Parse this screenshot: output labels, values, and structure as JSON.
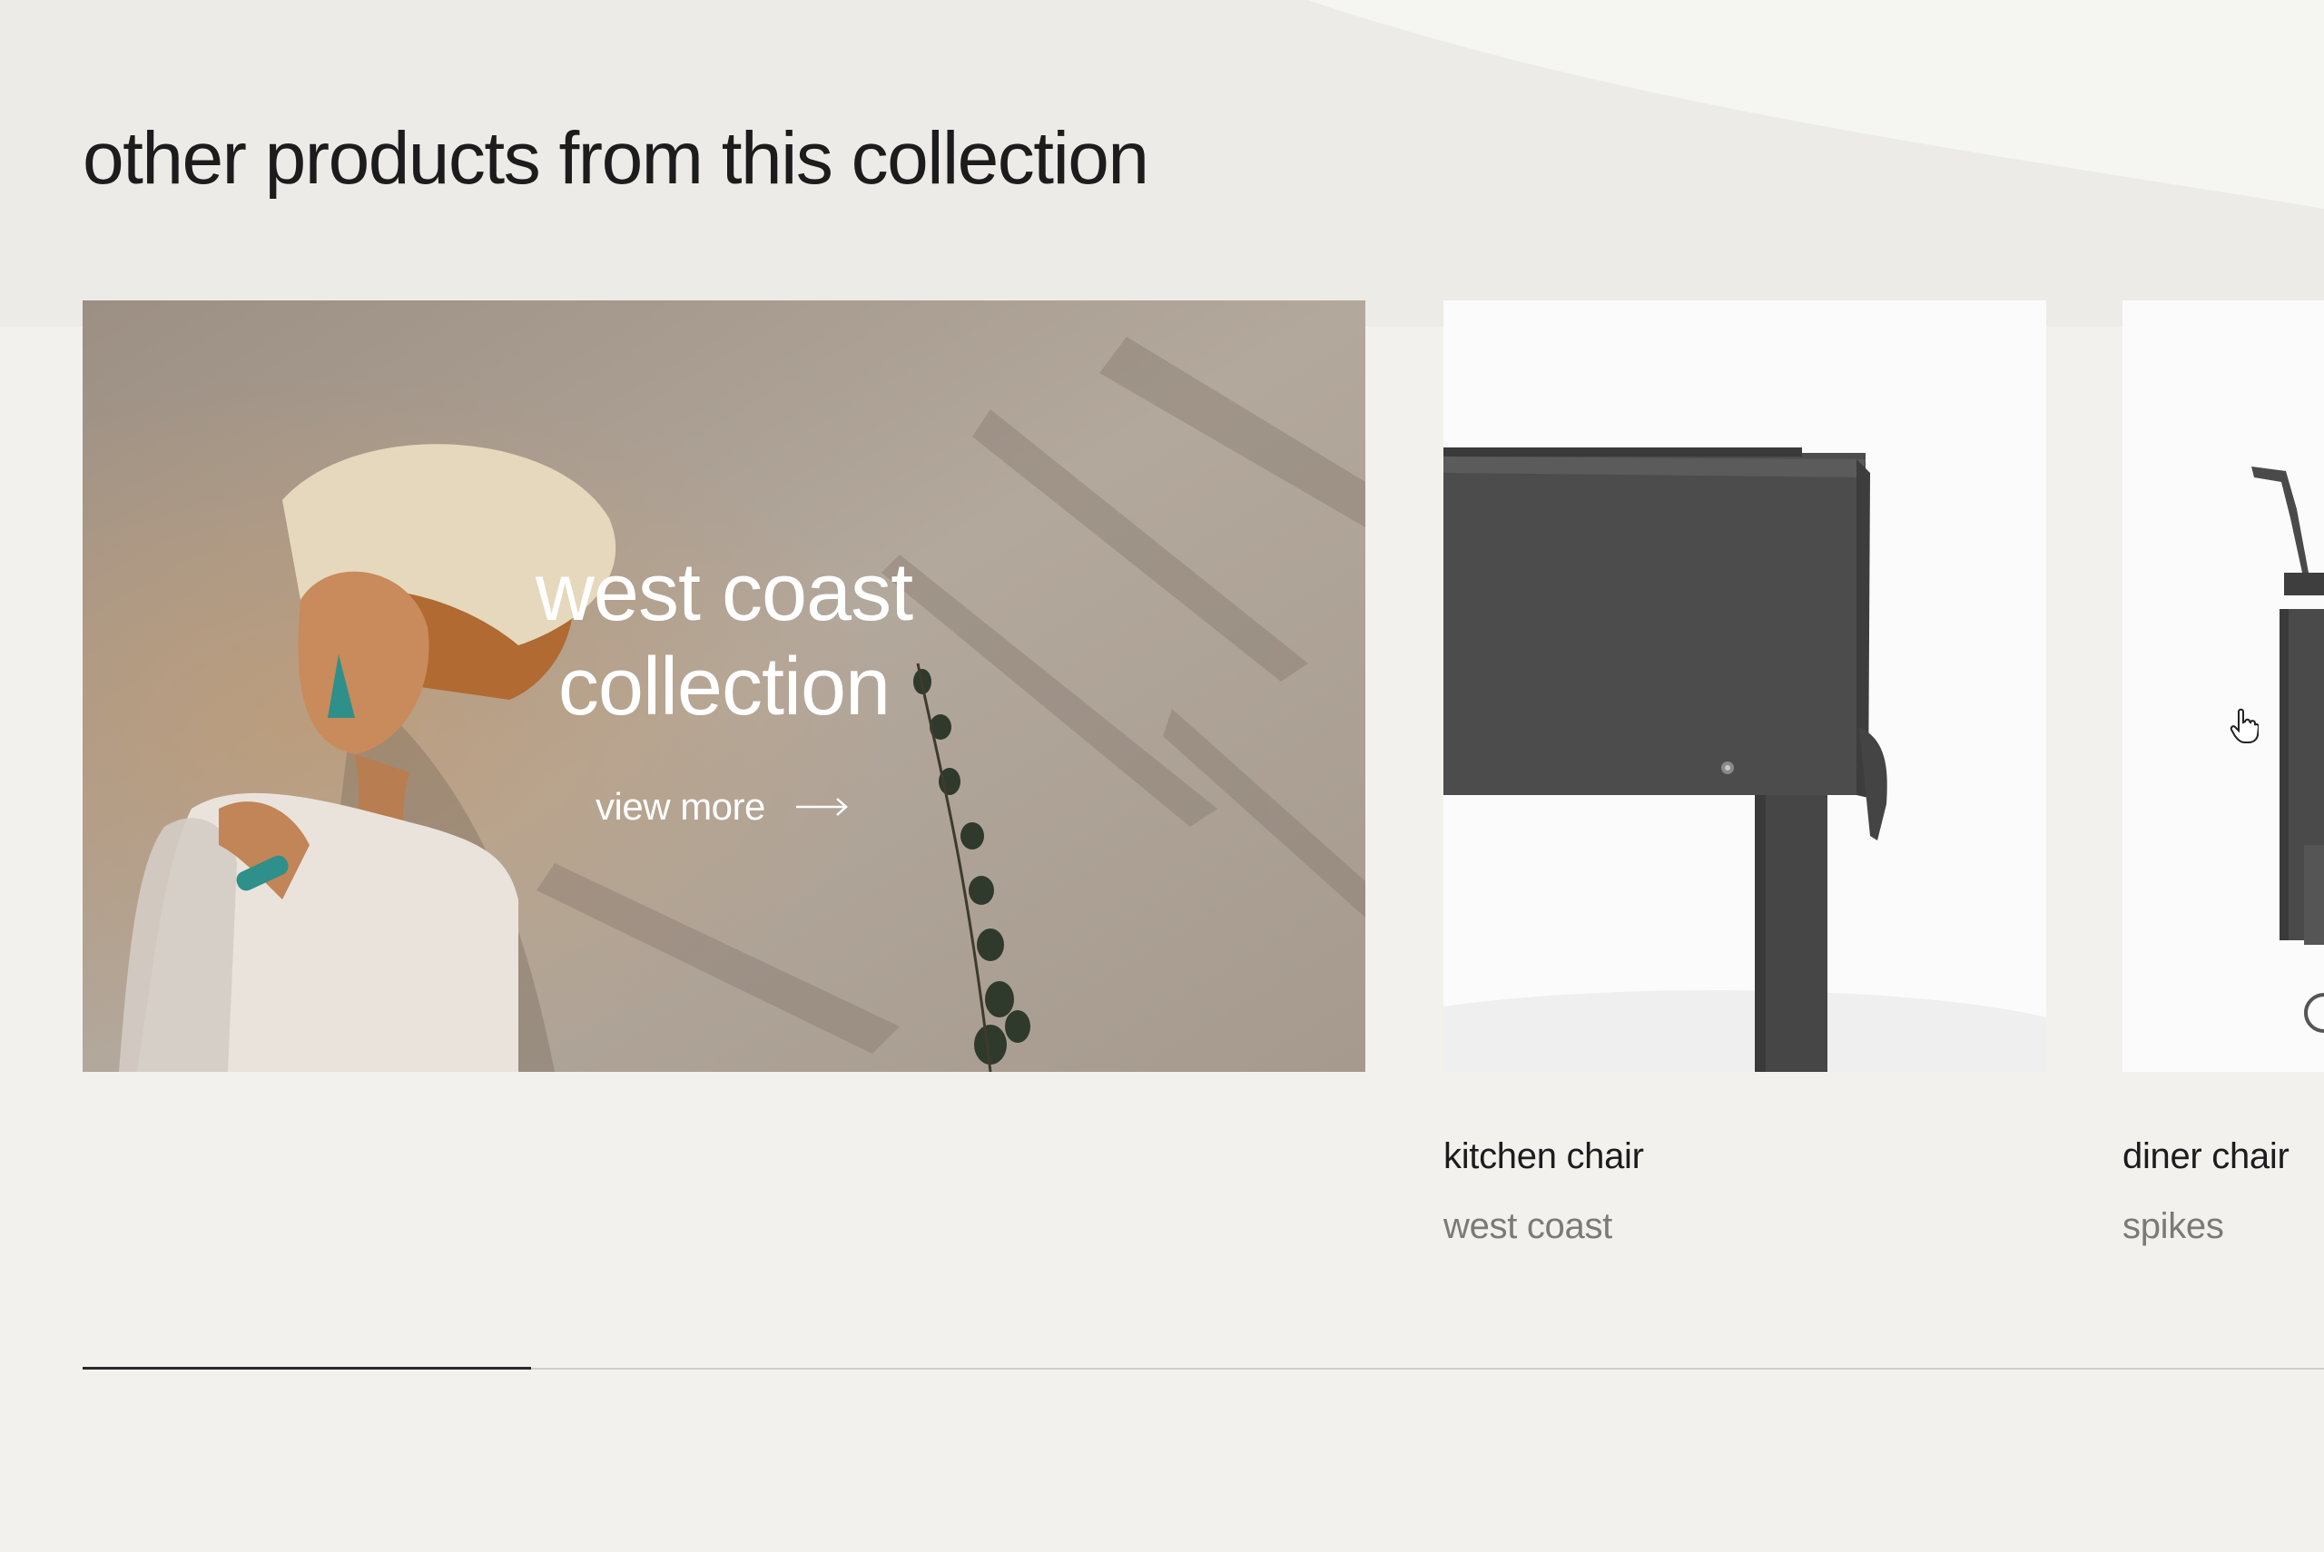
{
  "section": {
    "title": "other products from this collection"
  },
  "hero": {
    "title_line1": "west coast",
    "title_line2": "collection",
    "cta_label": "view more",
    "cta_icon": "arrow-right-icon"
  },
  "products": [
    {
      "name": "kitchen chair",
      "collection": "west coast"
    },
    {
      "name": "diner chair",
      "collection": "spikes"
    }
  ],
  "scroll_progress": 0.2,
  "colors": {
    "background": "#f2f1ee",
    "text": "#1c1c1c",
    "muted_text": "#7a7a78",
    "track": "#cfcecb",
    "track_fill": "#2a2a2a",
    "chair_metal": "#4a4a4a"
  }
}
